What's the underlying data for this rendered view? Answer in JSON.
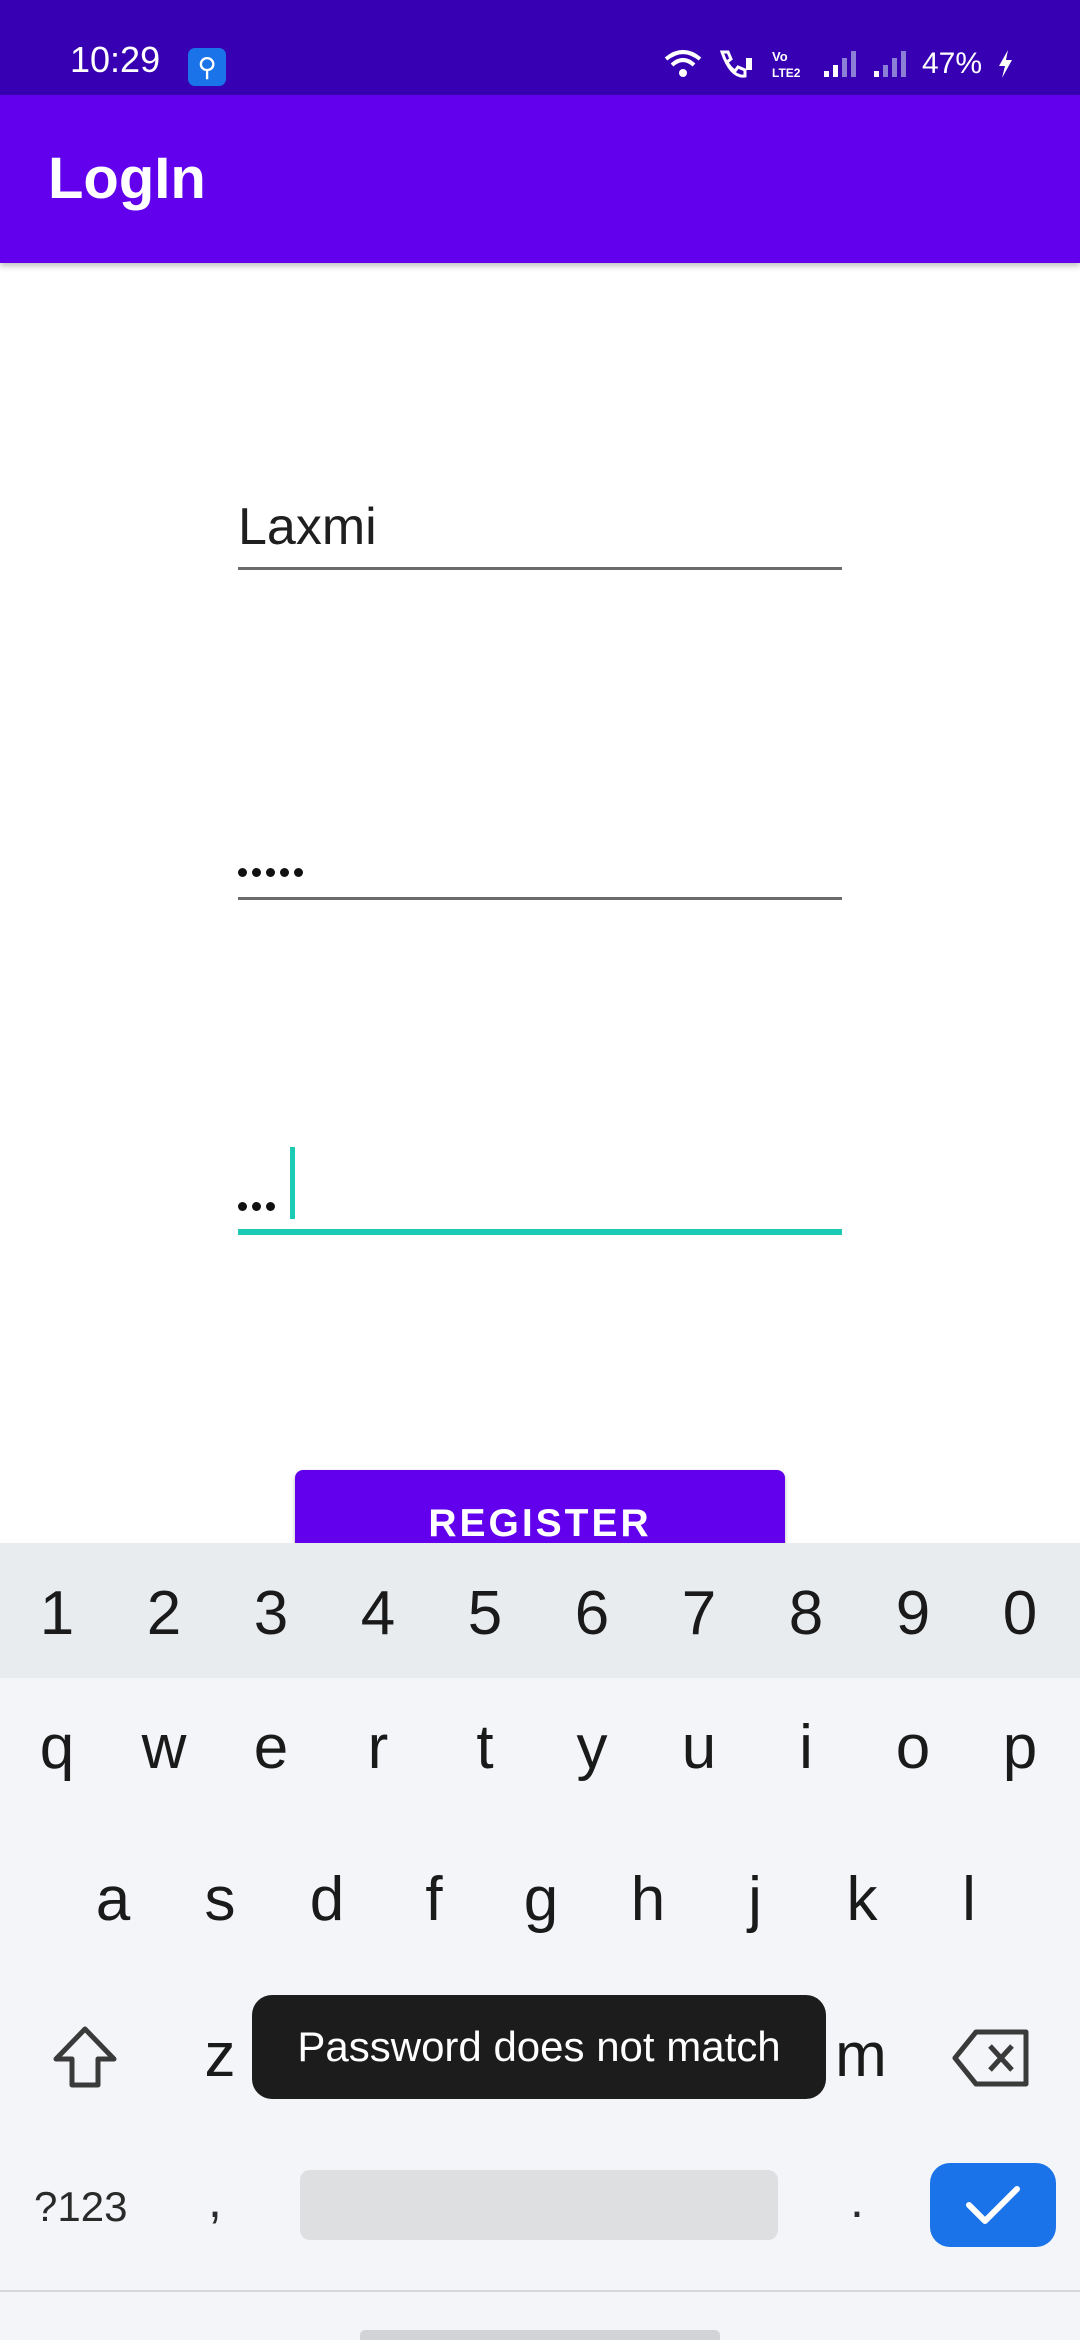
{
  "status_bar": {
    "time": "10:29",
    "usb_icon": "usb-icon",
    "battery": "47%",
    "icons": [
      "wifi-icon",
      "wifi-calling-icon",
      "volte-icon",
      "signal-icon",
      "signal-icon",
      "charging-icon"
    ]
  },
  "app_bar": {
    "title": "LogIn"
  },
  "form": {
    "username_value": "Laxmi",
    "password_mask": "•••••",
    "confirm_password_mask": "•••",
    "register_label": "REGISTER"
  },
  "keyboard": {
    "number_row": [
      "1",
      "2",
      "3",
      "4",
      "5",
      "6",
      "7",
      "8",
      "9",
      "0"
    ],
    "row1": [
      "q",
      "w",
      "e",
      "r",
      "t",
      "y",
      "u",
      "i",
      "o",
      "p"
    ],
    "row2": [
      "a",
      "s",
      "d",
      "f",
      "g",
      "h",
      "j",
      "k",
      "l"
    ],
    "row3_visible": [
      "z",
      "m"
    ],
    "symbols_label": "?123",
    "comma": ",",
    "period": "."
  },
  "toast": {
    "message": "Password does not match"
  },
  "colors": {
    "status_bar": "#3700b3",
    "primary": "#6200ee",
    "accent": "#1ccbb4",
    "keyboard_enter": "#1a73e8"
  }
}
